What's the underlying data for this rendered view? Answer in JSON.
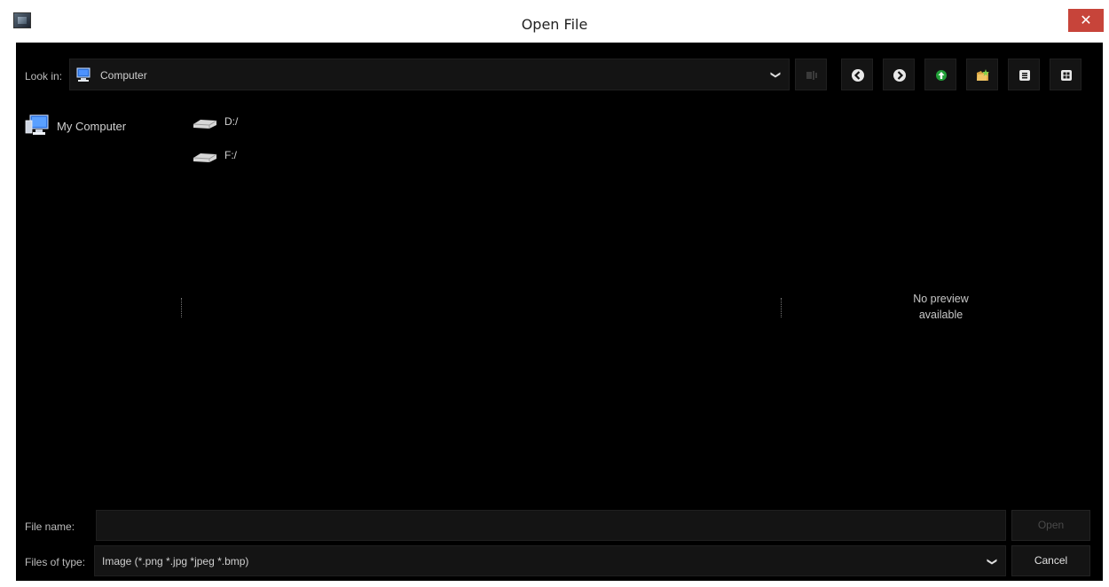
{
  "window": {
    "title": "Open File",
    "close_glyph": "✕"
  },
  "toolbar": {
    "look_in_label": "Look in:",
    "look_in_value": "Computer",
    "look_in_icon": "computer-icon",
    "buttons": [
      {
        "name": "new-folder-disabled-icon"
      },
      {
        "name": "back-icon"
      },
      {
        "name": "forward-icon"
      },
      {
        "name": "parent-directory-icon"
      },
      {
        "name": "create-folder-icon"
      },
      {
        "name": "list-view-icon"
      },
      {
        "name": "detail-view-icon"
      }
    ]
  },
  "sidebar": {
    "items": [
      {
        "label": "My Computer",
        "icon": "computer-icon"
      }
    ]
  },
  "files": {
    "items": [
      {
        "label": "D:/",
        "icon": "drive-icon"
      },
      {
        "label": "F:/",
        "icon": "drive-icon"
      }
    ]
  },
  "preview": {
    "text_line1": "No preview",
    "text_line2": "available"
  },
  "footer": {
    "file_name_label": "File name:",
    "file_name_value": "",
    "open_label": "Open",
    "files_of_type_label": "Files of type:",
    "files_of_type_value": "Image (*.png *.jpg *jpeg *.bmp)",
    "cancel_label": "Cancel"
  },
  "colors": {
    "background": "#000000",
    "panel": "#141414",
    "close_button": "#c7443a",
    "accent_green": "#21a038"
  }
}
